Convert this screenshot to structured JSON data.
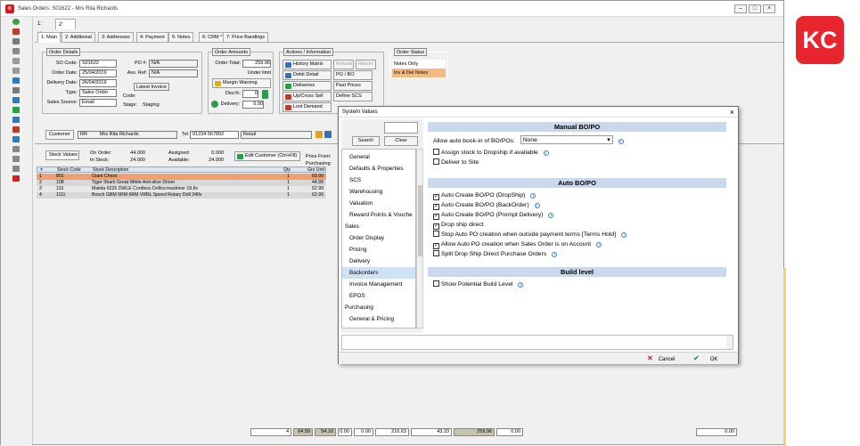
{
  "window": {
    "title": "Sales Orders: S01622 - Mrs Rita Richards"
  },
  "mode_tabs": [
    "1: List",
    "2: Detail"
  ],
  "sub_tabs": [
    "1: Main",
    "2: Additional",
    "3: Addresses",
    "4: Payment",
    "5: Notes",
    "6: CRM *",
    "7: Price Bandings"
  ],
  "order_details": {
    "label": "Order Details",
    "so_code_label": "SO Code:",
    "so_code": "S01622",
    "order_date_label": "Order Date:",
    "order_date": "25/04/2019",
    "delivery_date_label": "Delivery Date:",
    "delivery_date": "26/04/2019",
    "type_label": "Type:",
    "type": "Sales Order",
    "sales_source_label": "Sales Source:",
    "sales_source": "Email",
    "po_label": "PO #:",
    "po": "N/A",
    "ass_ref_label": "Ass. Ref:",
    "ass_ref": "N/A",
    "latest_invoice_label": "Latest Invoice",
    "code_label": "Code:",
    "stage_label": "Stage:",
    "stage": "Staging"
  },
  "order_amounts": {
    "label": "Order Amounts",
    "order_total_label": "Order Total:",
    "order_total": "259.96",
    "under_limit": "Under limit",
    "margin_warning": "Margin Warning",
    "disc_label": "Disc%:",
    "disc": "0",
    "delivery_label": "Delivery:",
    "delivery": "0.00"
  },
  "actions": {
    "label": "Actions / Information",
    "buttons": [
      "History Matrix",
      "Refund",
      "Return",
      "Debit Detail",
      "PO / BO",
      "Deliveries",
      "Past Prices",
      "Up/Cross Sell",
      "Define SCS",
      "Lost Demand"
    ]
  },
  "order_status": {
    "label": "Order Status",
    "items": [
      "Notes Only",
      "Inv & Del Notes"
    ]
  },
  "customer": {
    "label": "Customer",
    "code": "RR",
    "name": "Mrs Rita Richards",
    "tel_label": "Tel",
    "tel": "01234 567892",
    "price_band": "Retail"
  },
  "stock": {
    "label": "Stock Values",
    "on_order_label": "On Order:",
    "on_order": "44.000",
    "in_stock_label": "In Stock:",
    "in_stock": "24.000",
    "assigned_label": "Assigned:",
    "assigned": "0.000",
    "available_label": "Available:",
    "available": "24.000",
    "edit_customer": "Edit Customer (Ctrl+F8)",
    "price_from": "Price From:",
    "purchasing_label": "Purchasing:"
  },
  "grid": {
    "headers": [
      "Stock Code",
      "Stock Description",
      "Qty",
      "Grs Unit"
    ],
    "rows": [
      {
        "n": "1",
        "code": "801",
        "desc": "Giant Chess",
        "qty": "1",
        "unit": "69.99"
      },
      {
        "n": "2",
        "code": "108",
        "desc": "Tiger Shark Great White Anti-slice Driver",
        "qty": "1",
        "unit": "44.99"
      },
      {
        "n": "3",
        "code": "110",
        "desc": "Makita 6226 DWLE Cordless Drill/screwdriver 18.8v",
        "qty": "1",
        "unit": "62.99"
      },
      {
        "n": "4",
        "code": "1111",
        "desc": "Bosch GBM 6RM 6RM VRBL Speed Rotary Drill 240v",
        "qty": "1",
        "unit": "62.99"
      }
    ]
  },
  "dialog": {
    "title": "System Values",
    "search": "Search",
    "clear": "Clear",
    "tree": [
      {
        "t": "General",
        "d": 1
      },
      {
        "t": "Defaults & Properties",
        "d": 1
      },
      {
        "t": "SCS",
        "d": 1
      },
      {
        "t": "Warehousing",
        "d": 1
      },
      {
        "t": "Valuation",
        "d": 1
      },
      {
        "t": "Reward Points & Vouche",
        "d": 1
      },
      {
        "t": "Sales",
        "d": 0
      },
      {
        "t": "Order Display",
        "d": 1
      },
      {
        "t": "Pricing",
        "d": 1
      },
      {
        "t": "Delivery",
        "d": 1
      },
      {
        "t": "Backorders",
        "d": 1,
        "sel": true
      },
      {
        "t": "Invoice Management",
        "d": 1
      },
      {
        "t": "EPOS",
        "d": 1
      },
      {
        "t": "Purchasing",
        "d": 0
      },
      {
        "t": "General & Pricing",
        "d": 1
      }
    ],
    "manual_title": "Manual BO/PO",
    "auto_bookin_label": "Allow auto book-in of BO/POs:",
    "auto_bookin_value": "None",
    "manual_opts": [
      {
        "t": "Assign stock to Dropship if available",
        "c": false
      },
      {
        "t": "Deliver to Site",
        "c": false
      }
    ],
    "auto_title": "Auto BO/PO",
    "auto_opts": [
      {
        "t": "Auto Create BO/PO (DropShip)",
        "c": true
      },
      {
        "t": "Auto Create BO/PO (BackOrder)",
        "c": true
      },
      {
        "t": "Auto Create BO/PO (Prompt Delivery)",
        "c": true
      },
      {
        "t": "Drop ship direct",
        "c": true
      },
      {
        "t": "Stop Auto PO creation when outside payment terms [Terms Hold]",
        "c": false
      },
      {
        "t": "Allow Auto PO creation when Sales Order is on Account",
        "c": true
      },
      {
        "t": "Split Drop Ship Direct Purchase Orders",
        "c": false
      }
    ],
    "build_title": "Build level",
    "build_opts": [
      {
        "t": "Show Potential Build Level",
        "c": false
      }
    ],
    "cancel": "Cancel",
    "ok": "OK"
  },
  "footer": [
    "4",
    "64.99",
    "54.16",
    "0.00",
    "0.00",
    "216.63",
    "43.33",
    "259.96",
    "0.00",
    "0.00"
  ],
  "brand": {
    "logo": "KC",
    "color": "#e8252f"
  }
}
